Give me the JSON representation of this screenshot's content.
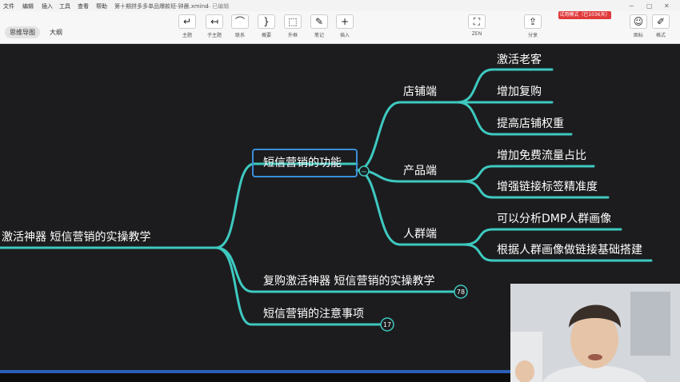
{
  "menu": {
    "items": [
      "文件",
      "编辑",
      "插入",
      "工具",
      "查看",
      "帮助"
    ],
    "doc_title": "第十期拼多多单品爆款班-钟晨.xmind",
    "status": "— 已编辑"
  },
  "view_tabs": [
    "思维导图",
    "大纲"
  ],
  "toolbar": {
    "buttons": [
      {
        "label": "主题",
        "icon": "topic-icon",
        "glyph": "↵"
      },
      {
        "label": "子主题",
        "icon": "subtopic-icon",
        "glyph": "↤"
      },
      {
        "label": "联系",
        "icon": "relationship-icon",
        "glyph": "⌒"
      },
      {
        "label": "概要",
        "icon": "summary-icon",
        "glyph": "}"
      },
      {
        "label": "外框",
        "icon": "boundary-icon",
        "glyph": "⬚"
      },
      {
        "label": "笔记",
        "icon": "note-icon",
        "glyph": "✎"
      },
      {
        "label": "插入",
        "icon": "insert-icon",
        "glyph": "+"
      }
    ],
    "zen_label": "ZEN",
    "share_label": "分享",
    "icon_panel_label": "图标",
    "format_label": "格式",
    "trial_badge": "试用模式（已1036天）"
  },
  "mindmap": {
    "root_label": "激活神器    短信营销的实操教学",
    "branch_selected": "短信营销的功能",
    "sub": [
      {
        "label": "店铺端",
        "children": [
          "激活老客",
          "增加复购",
          "提高店铺权重"
        ]
      },
      {
        "label": "产品端",
        "children": [
          "增加免费流量占比",
          "增强链接标签精准度"
        ]
      },
      {
        "label": "人群端",
        "children": [
          "可以分析DMP人群画像",
          "根据人群画像做链接基础搭建"
        ]
      }
    ],
    "branch2": {
      "label": "复购激活神器 短信营销的实操教学",
      "count": "78"
    },
    "branch3": {
      "label": "短信营销的注意事项",
      "count": "17"
    },
    "collapse_symbol": "−"
  },
  "colors": {
    "line": "#3ec9c0",
    "selection": "#3a8fd9",
    "canvas": "#1c1c1e",
    "trial_badge": "#e03a3a"
  }
}
